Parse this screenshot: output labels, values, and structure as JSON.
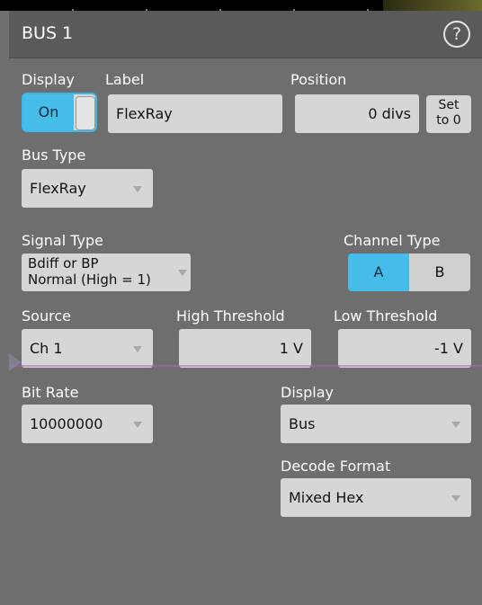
{
  "header": {
    "title": "BUS 1",
    "help_glyph": "?"
  },
  "display_section": {
    "display_label": "Display",
    "display_toggle": "On",
    "label_label": "Label",
    "label_value": "FlexRay",
    "position_label": "Position",
    "position_value": "0 divs",
    "set_to_zero_line1": "Set",
    "set_to_zero_line2": "to 0"
  },
  "bus_type": {
    "label": "Bus Type",
    "value": "FlexRay"
  },
  "signal_type": {
    "label": "Signal Type",
    "line1": "Bdiff or BP",
    "line2": "Normal (High = 1)"
  },
  "channel_type": {
    "label": "Channel Type",
    "options": [
      "A",
      "B"
    ],
    "selected": "A"
  },
  "source": {
    "label": "Source",
    "value": "Ch 1"
  },
  "high_threshold": {
    "label": "High Threshold",
    "value": "1 V"
  },
  "low_threshold": {
    "label": "Low Threshold",
    "value": "-1 V"
  },
  "bit_rate": {
    "label": "Bit Rate",
    "value": "10000000"
  },
  "display_mode": {
    "label": "Display",
    "value": "Bus"
  },
  "decode_format": {
    "label": "Decode Format",
    "value": "Mixed Hex"
  },
  "colors": {
    "accent": "#45bde8",
    "panel": "#6e6e6e",
    "header": "#5a5a5a",
    "field": "#d6d6d6"
  }
}
